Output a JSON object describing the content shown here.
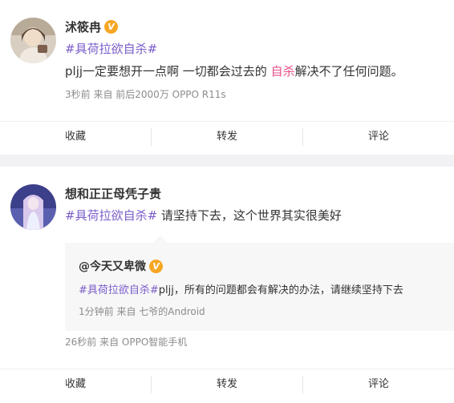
{
  "post1": {
    "username": "沭筱冉",
    "badge": "V",
    "hashtag": "#具荷拉欲自杀#",
    "text_before": "pljj一定要想开一点啊 一切都会过去的 ",
    "text_link": "自杀",
    "text_after": "解决不了任何问题。",
    "meta": "3秒前 来自 前后2000万 OPPO R11s"
  },
  "post2": {
    "username": "想和正正母凭子贵",
    "hashtag": "#具荷拉欲自杀#",
    "text": " 请坚持下去，这个世界其实很美好",
    "quote": {
      "username": "@今天又卑微",
      "badge": "V",
      "hashtag": "#具荷拉欲自杀#",
      "text": "pljj，所有的问题都会有解决的办法，请继续坚持下去",
      "meta": "1分钟前 来自 七爷的Android"
    },
    "meta": "26秒前 来自 OPPO智能手机"
  },
  "actions": {
    "favorite": "收藏",
    "repost": "转发",
    "comment": "评论"
  },
  "colors": {
    "hashtag": "#7a5cc9",
    "highlight": "#e8508a",
    "badge": "#f6a623",
    "meta": "#8c8c8c",
    "separator": "#f2f2f5"
  }
}
